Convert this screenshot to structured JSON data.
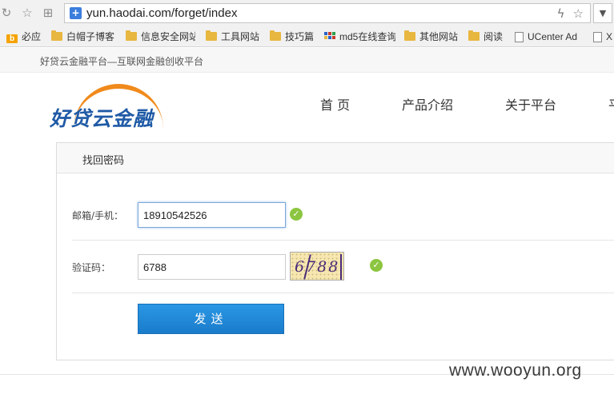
{
  "browser": {
    "url": "yun.haodai.com/forget/index",
    "bookmarks": [
      {
        "label": "必应",
        "icon": "bing-icon"
      },
      {
        "label": "白帽子博客",
        "icon": "folder-icon"
      },
      {
        "label": "信息安全网站",
        "icon": "folder-icon"
      },
      {
        "label": "工具网站",
        "icon": "folder-icon"
      },
      {
        "label": "技巧篇",
        "icon": "folder-icon"
      },
      {
        "label": "md5在线查询",
        "icon": "grid-icon"
      },
      {
        "label": "其他网站",
        "icon": "folder-icon"
      },
      {
        "label": "阅读",
        "icon": "folder-icon"
      },
      {
        "label": "UCenter Ad",
        "icon": "page-icon"
      },
      {
        "label": "X",
        "icon": "page-icon"
      }
    ]
  },
  "site": {
    "slogan": "好贷云金融平台—互联网金融创收平台",
    "logo_text": "好贷云金融",
    "nav": [
      "首 页",
      "产品介绍",
      "关于平台",
      "平"
    ]
  },
  "form": {
    "title": "找回密码",
    "account_label": "邮箱/手机：",
    "account_value": "18910542526",
    "captcha_label": "验证码：",
    "captcha_value": "6788",
    "captcha_image_text": "6788",
    "submit_label": "发送"
  },
  "watermark": "www.wooyun.org",
  "colors": {
    "brand_blue": "#1f5aa6",
    "brand_orange": "#f08a1c",
    "button_blue": "#1a7ccb",
    "success_green": "#8cc540"
  }
}
